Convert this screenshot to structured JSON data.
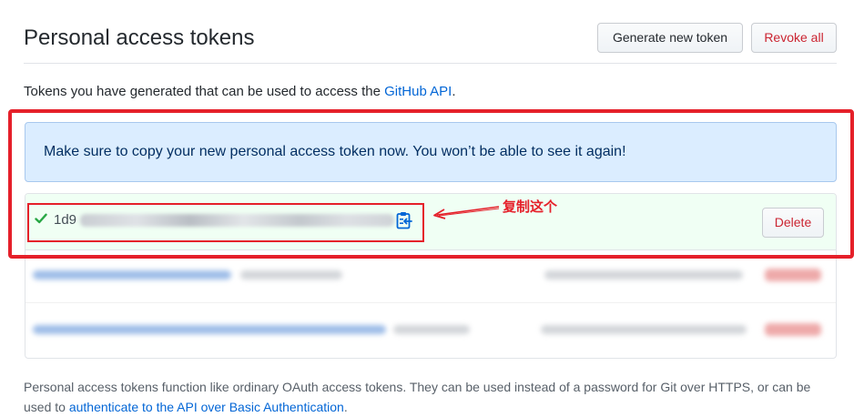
{
  "header": {
    "title": "Personal access tokens",
    "generate_label": "Generate new token",
    "revoke_label": "Revoke all"
  },
  "intro": {
    "text_before": "Tokens you have generated that can be used to access the ",
    "link_text": "GitHub API",
    "text_after": "."
  },
  "flash": {
    "message": "Make sure to copy your new personal access token now. You won’t be able to see it again!"
  },
  "new_token": {
    "prefix": "1d9",
    "delete_label": "Delete",
    "icons": [
      "check-icon",
      "clipboard-icon"
    ]
  },
  "annotation": {
    "label": "复制这个"
  },
  "footer": {
    "text_before": "Personal access tokens function like ordinary OAuth access tokens. They can be used instead of a password for Git over HTTPS, or can be used to ",
    "link_text": "authenticate to the API over Basic Authentication",
    "text_after": "."
  },
  "colors": {
    "link": "#0366d6",
    "danger": "#cb2431",
    "annotation_red": "#e5202a",
    "flash_bg": "#dbedff",
    "success_bg": "#f0fff4",
    "check_green": "#28a745"
  }
}
